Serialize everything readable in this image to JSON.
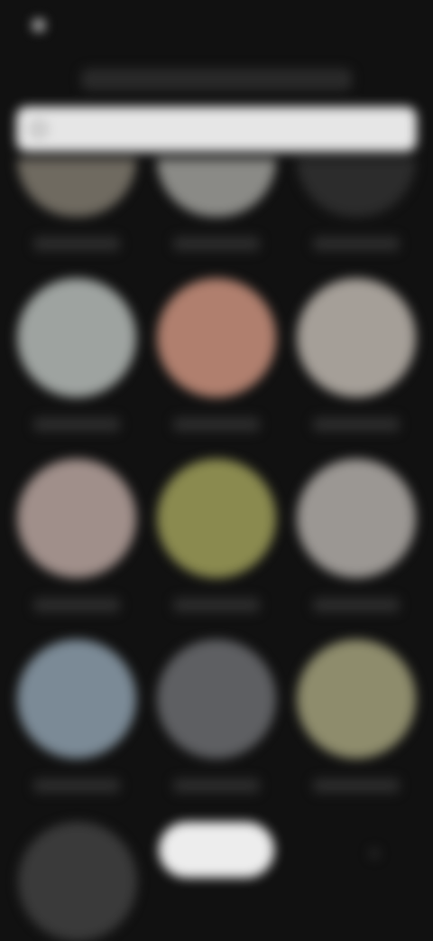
{
  "status": {
    "time": "",
    "right": ""
  },
  "header": {
    "title": ""
  },
  "search": {
    "placeholder": "",
    "value": ""
  },
  "grid": {
    "rows": [
      [
        {
          "label": "",
          "color": "#6f6a60"
        },
        {
          "label": "",
          "color": "#8a8a86"
        },
        {
          "label": "",
          "color": "#2c2c2c"
        }
      ],
      [
        {
          "label": "",
          "color": "#9ea3a0"
        },
        {
          "label": "",
          "color": "#b07f6e"
        },
        {
          "label": "",
          "color": "#a59f98"
        }
      ],
      [
        {
          "label": "",
          "color": "#a08f8a"
        },
        {
          "label": "",
          "color": "#8a8a4f"
        },
        {
          "label": "",
          "color": "#9b9793"
        }
      ],
      [
        {
          "label": "",
          "color": "#7b8a96"
        },
        {
          "label": "",
          "color": "#5e5f62"
        },
        {
          "label": "",
          "color": "#8e8c6c"
        }
      ]
    ]
  },
  "fab": {
    "label": ""
  },
  "icons": {
    "status": "circle-icon",
    "search": "search-icon"
  }
}
